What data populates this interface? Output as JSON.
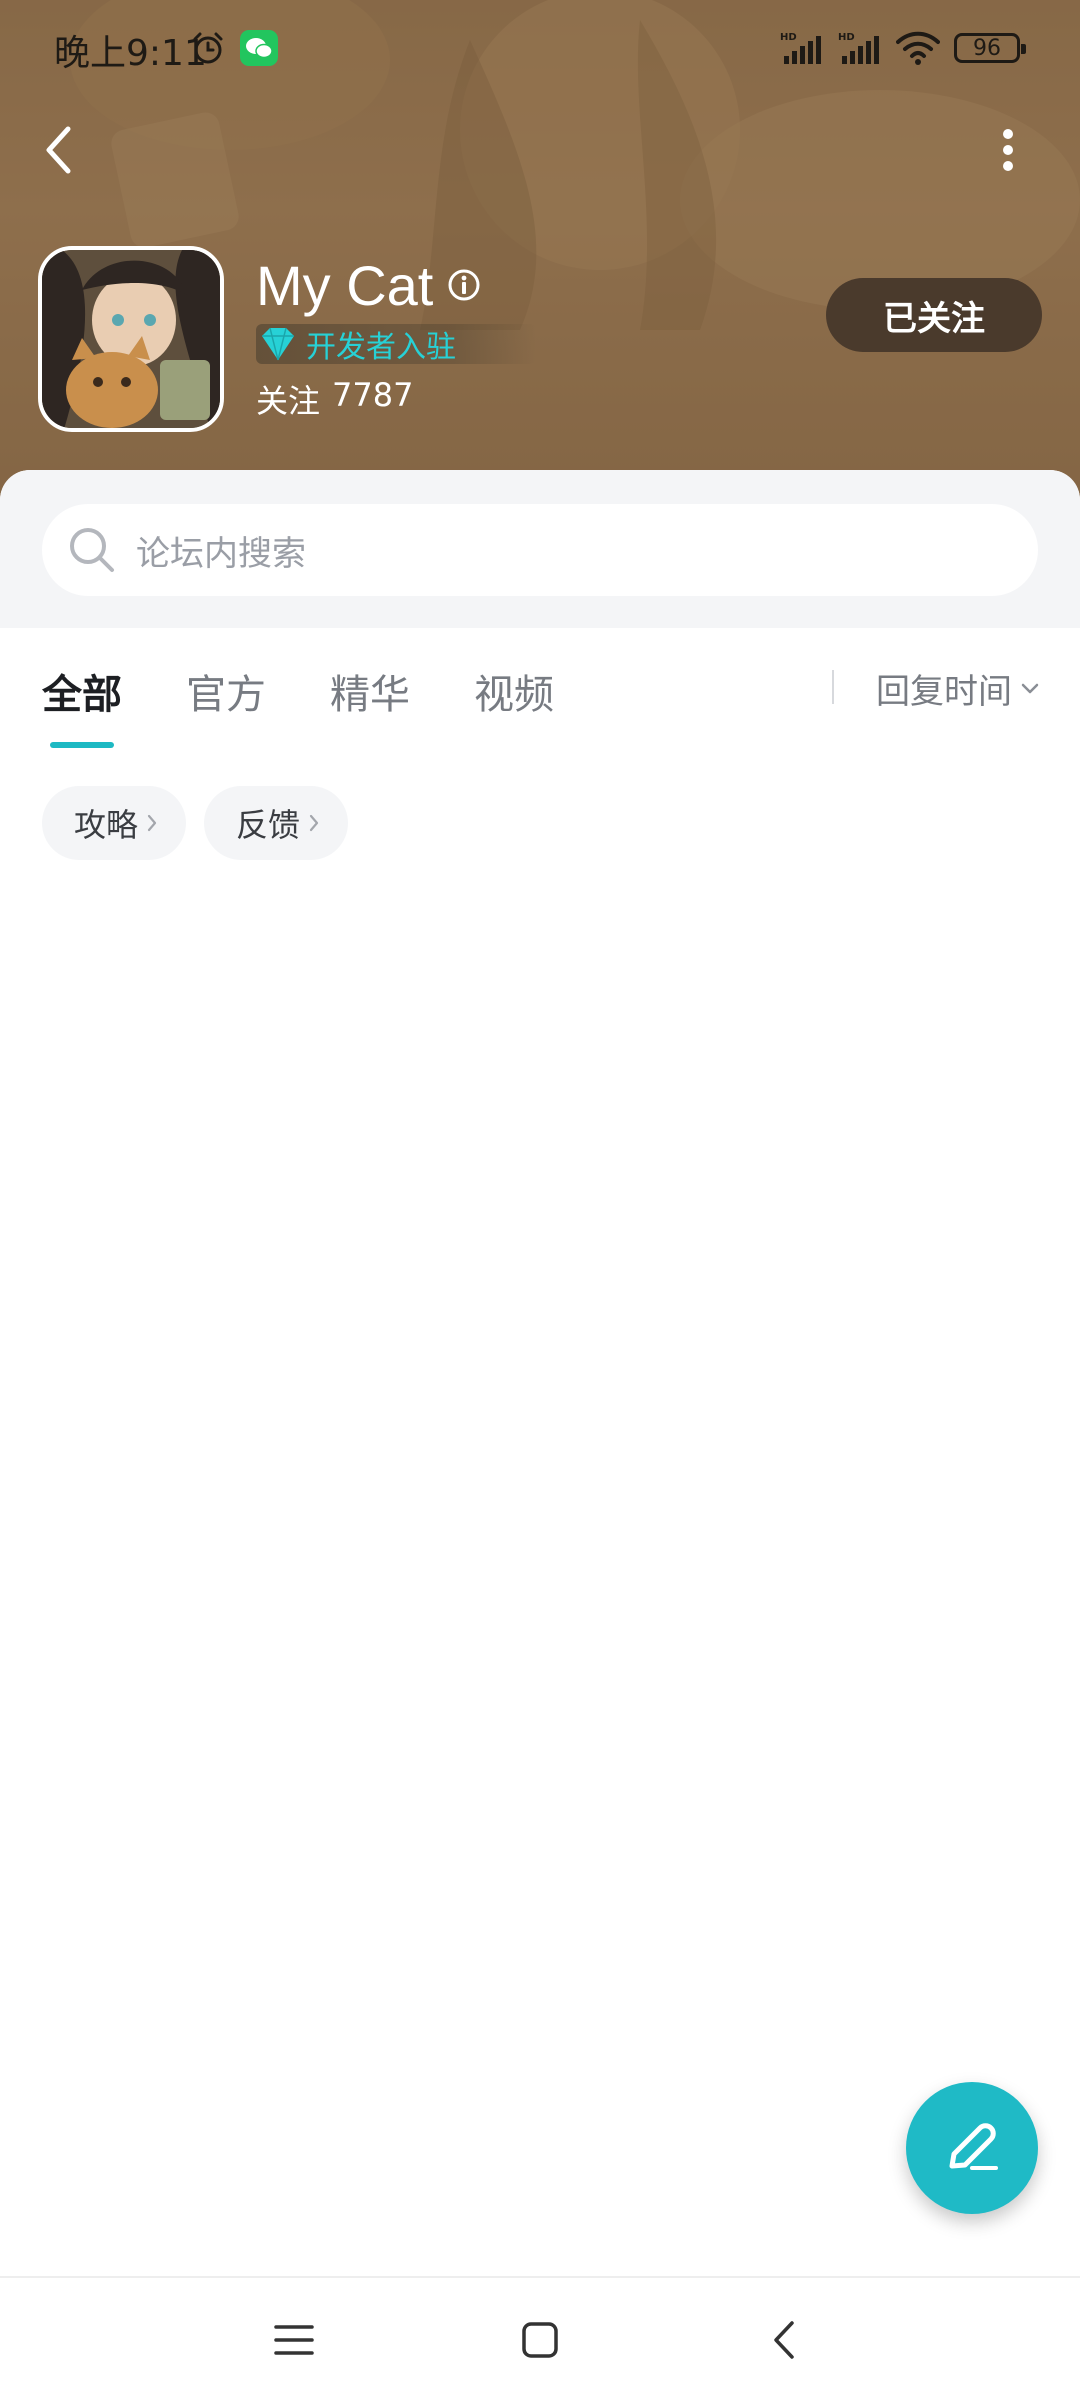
{
  "status_bar": {
    "time": "晚上9:11",
    "battery": "96",
    "icons": [
      "alarm-icon",
      "wechat-icon",
      "signal-hd-icon",
      "signal-hd-icon",
      "wifi-icon",
      "battery-icon"
    ]
  },
  "nav": {
    "back_icon": "chevron-left-icon",
    "more_icon": "more-vertical-icon"
  },
  "forum": {
    "title": "My Cat",
    "info_icon": "info-icon",
    "badge_label": "开发者入驻",
    "follow_label": "关注",
    "follow_count": "7787",
    "follow_button": "已关注"
  },
  "search": {
    "placeholder": "论坛内搜索"
  },
  "tabs": [
    {
      "label": "全部",
      "active": true
    },
    {
      "label": "官方",
      "active": false
    },
    {
      "label": "精华",
      "active": false
    },
    {
      "label": "视频",
      "active": false
    }
  ],
  "sort": {
    "label": "回复时间"
  },
  "chips": [
    {
      "label": "攻略"
    },
    {
      "label": "反馈"
    }
  ],
  "fab": {
    "icon": "edit-pen-icon"
  },
  "system_nav": {
    "icons": [
      "menu-icon",
      "home-square-icon",
      "back-chevron-icon"
    ]
  },
  "colors": {
    "accent": "#1fbac6",
    "badge_text": "#27d1d6",
    "hero_bg": "#8f7150",
    "follow_button_bg": "#4a3a2c"
  }
}
